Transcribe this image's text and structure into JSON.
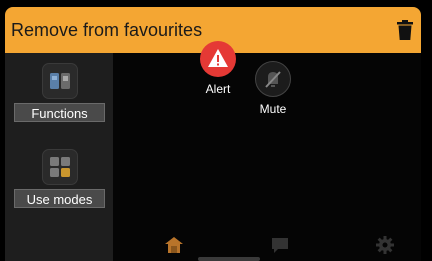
{
  "header": {
    "title": "Remove from favourites",
    "icon": "trash-icon"
  },
  "sidebar": {
    "items": [
      {
        "label": "Functions",
        "icon": "functions-icon"
      },
      {
        "label": "Use modes",
        "icon": "use-modes-icon"
      }
    ]
  },
  "favourites": [
    {
      "label": "Alert",
      "icon": "alert-icon",
      "color": "#e53935"
    },
    {
      "label": "Mute",
      "icon": "mute-icon",
      "color": "#2a2a2a"
    }
  ],
  "bottom_nav": [
    {
      "icon": "home-icon",
      "active": true,
      "color": "#b8742a"
    },
    {
      "icon": "chat-icon",
      "active": false,
      "color": "#333333"
    },
    {
      "icon": "settings-icon",
      "active": false,
      "color": "#333333"
    }
  ],
  "colors": {
    "accent": "#f4a633",
    "alert": "#e53935"
  }
}
